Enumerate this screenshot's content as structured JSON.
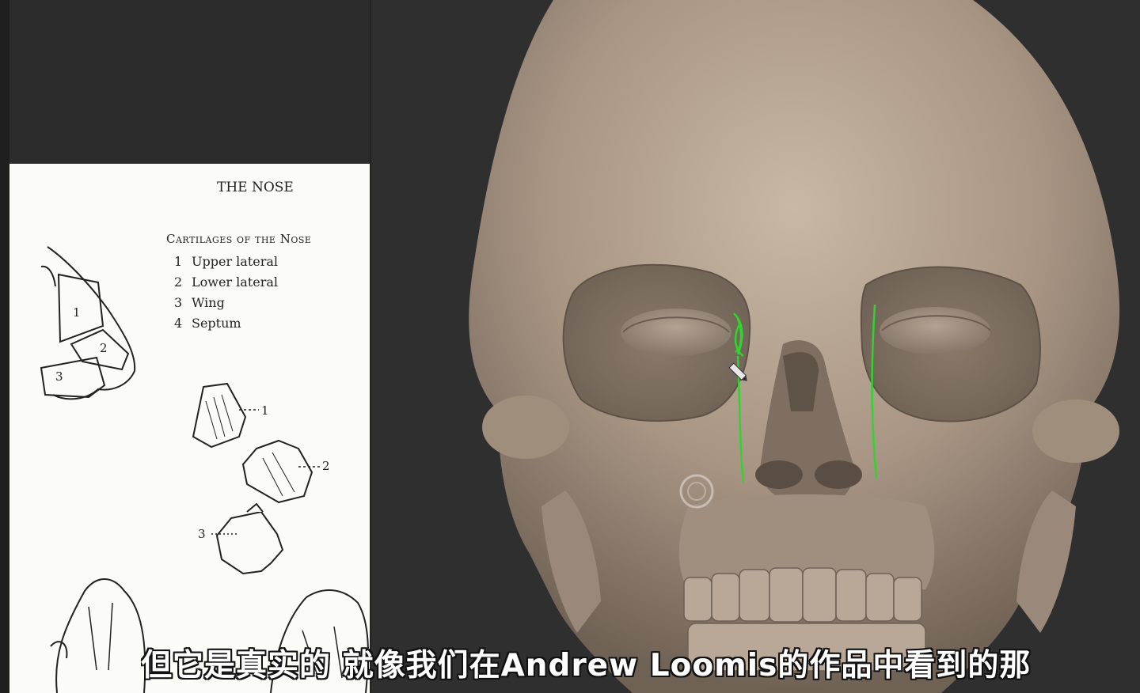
{
  "reference_page": {
    "title": "THE NOSE",
    "heading": "Cartilages of the Nose",
    "items": [
      {
        "number": "1",
        "label": "Upper lateral"
      },
      {
        "number": "2",
        "label": "Lower lateral"
      },
      {
        "number": "3",
        "label": "Wing"
      },
      {
        "number": "4",
        "label": "Septum"
      }
    ],
    "figure_callouts": [
      "1",
      "2",
      "3"
    ]
  },
  "subtitle": {
    "text": "但它是真实的 就像我们在Andrew Loomis的作品中看到的那"
  },
  "colors": {
    "background": "#2d2d2d",
    "skull": "#a89686",
    "stroke": "#2fd42f",
    "subtitle": "#ffffff"
  }
}
